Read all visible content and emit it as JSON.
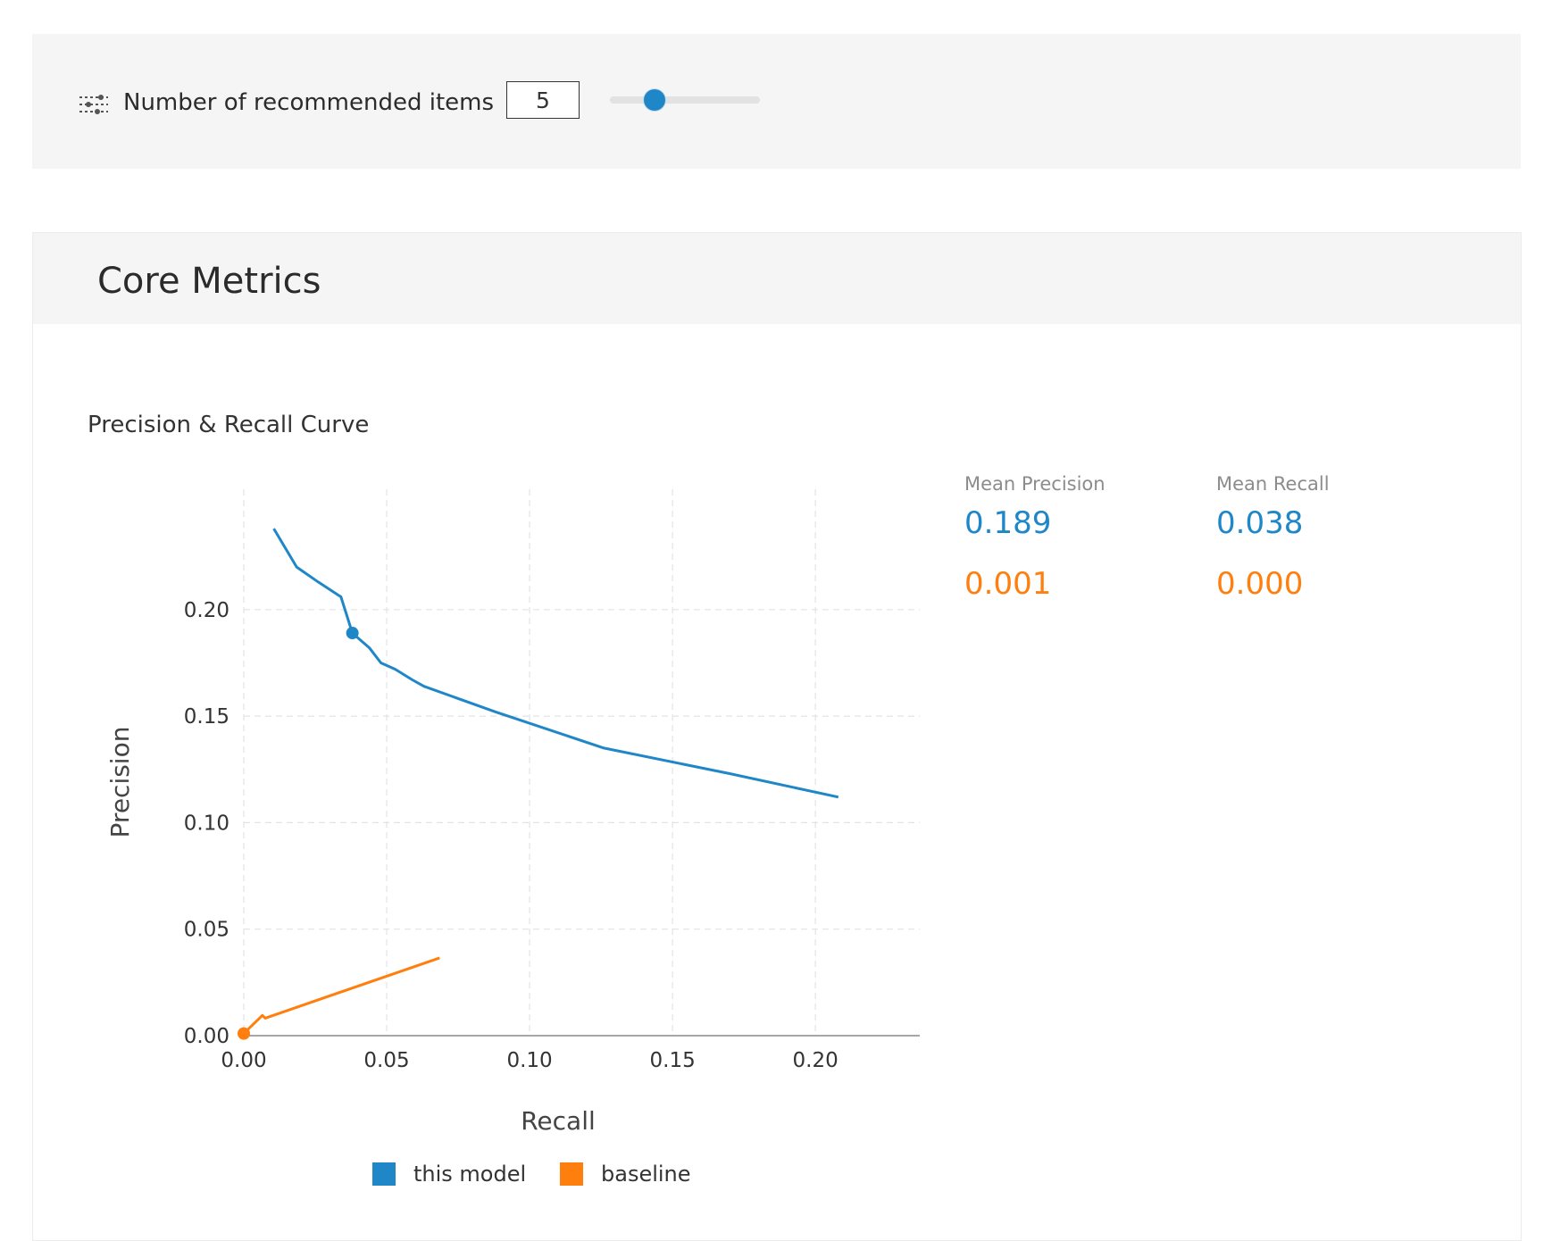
{
  "controls": {
    "label": "Number of recommended items",
    "icon": "sliders-icon",
    "value": "5",
    "slider_fraction": 0.3
  },
  "panel": {
    "title": "Core Metrics"
  },
  "chart_section": {
    "title": "Precision & Recall Curve"
  },
  "metrics": {
    "mean_precision_label": "Mean Precision",
    "mean_recall_label": "Mean Recall",
    "rows": [
      {
        "precision": "0.189",
        "recall": "0.038",
        "color": "#1f87c8"
      },
      {
        "precision": "0.001",
        "recall": "0.000",
        "color": "#ff7f0e"
      }
    ]
  },
  "chart_data": {
    "type": "line",
    "title": "",
    "xlabel": "Recall",
    "ylabel": "Precision",
    "xlim": [
      0,
      0.2365
    ],
    "ylim": [
      0,
      0.2565
    ],
    "x_ticks": [
      "0.00",
      "0.05",
      "0.10",
      "0.15",
      "0.20"
    ],
    "x_tick_values": [
      0.0,
      0.05,
      0.1,
      0.15,
      0.2
    ],
    "y_ticks": [
      "0.00",
      "0.05",
      "0.10",
      "0.15",
      "0.20"
    ],
    "y_tick_values": [
      0.0,
      0.05,
      0.1,
      0.15,
      0.2
    ],
    "grid": true,
    "legend_position": "bottom",
    "series": [
      {
        "name": "this model",
        "color": "#1f87c8",
        "x": [
          0.0105,
          0.0185,
          0.026,
          0.034,
          0.038,
          0.044,
          0.048,
          0.053,
          0.059,
          0.063,
          0.088,
          0.126,
          0.17,
          0.208
        ],
        "y": [
          0.238,
          0.22,
          0.213,
          0.206,
          0.189,
          0.182,
          0.175,
          0.172,
          0.167,
          0.164,
          0.152,
          0.135,
          0.123,
          0.112
        ],
        "marker": {
          "x": 0.038,
          "y": 0.189
        }
      },
      {
        "name": "baseline",
        "color": "#ff7f0e",
        "x": [
          0.0,
          0.0065,
          0.0075,
          0.0685
        ],
        "y": [
          0.001,
          0.0095,
          0.0082,
          0.0365
        ],
        "marker": {
          "x": 0.0,
          "y": 0.001
        }
      }
    ]
  }
}
